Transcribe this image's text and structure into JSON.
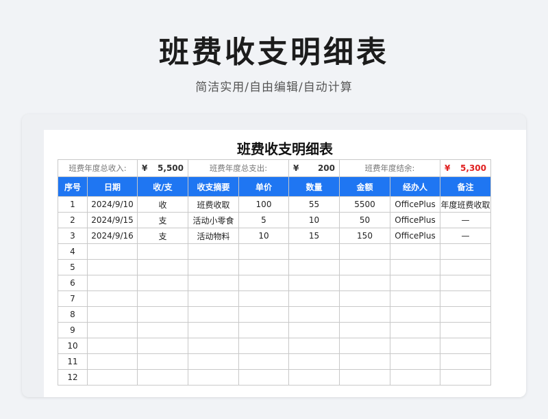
{
  "header": {
    "title": "班费收支明细表",
    "subtitle": "简洁实用/自由编辑/自动计算"
  },
  "sheet": {
    "title": "班费收支明细表",
    "summary": {
      "income_label": "班费年度总收入:",
      "income_currency": "¥",
      "income_value": "5,500",
      "expense_label": "班费年度总支出:",
      "expense_currency": "¥",
      "expense_value": "200",
      "balance_label": "班费年度结余:",
      "balance_currency": "¥",
      "balance_value": "5,300"
    },
    "columns": [
      "序号",
      "日期",
      "收/支",
      "收支摘要",
      "单价",
      "数量",
      "金额",
      "经办人",
      "备注"
    ],
    "rows": [
      [
        "1",
        "2024/9/10",
        "收",
        "班费收取",
        "100",
        "55",
        "5500",
        "OfficePlus",
        "年度班费收取"
      ],
      [
        "2",
        "2024/9/15",
        "支",
        "活动小零食",
        "5",
        "10",
        "50",
        "OfficePlus",
        "—"
      ],
      [
        "3",
        "2024/9/16",
        "支",
        "活动物料",
        "10",
        "15",
        "150",
        "OfficePlus",
        "—"
      ],
      [
        "4",
        "",
        "",
        "",
        "",
        "",
        "",
        "",
        ""
      ],
      [
        "5",
        "",
        "",
        "",
        "",
        "",
        "",
        "",
        ""
      ],
      [
        "6",
        "",
        "",
        "",
        "",
        "",
        "",
        "",
        ""
      ],
      [
        "7",
        "",
        "",
        "",
        "",
        "",
        "",
        "",
        ""
      ],
      [
        "8",
        "",
        "",
        "",
        "",
        "",
        "",
        "",
        ""
      ],
      [
        "9",
        "",
        "",
        "",
        "",
        "",
        "",
        "",
        ""
      ],
      [
        "10",
        "",
        "",
        "",
        "",
        "",
        "",
        "",
        ""
      ],
      [
        "11",
        "",
        "",
        "",
        "",
        "",
        "",
        "",
        ""
      ],
      [
        "12",
        "",
        "",
        "",
        "",
        "",
        "",
        "",
        ""
      ]
    ]
  },
  "colors": {
    "header_blue": "#1f76f2",
    "balance_red": "#e02020"
  }
}
